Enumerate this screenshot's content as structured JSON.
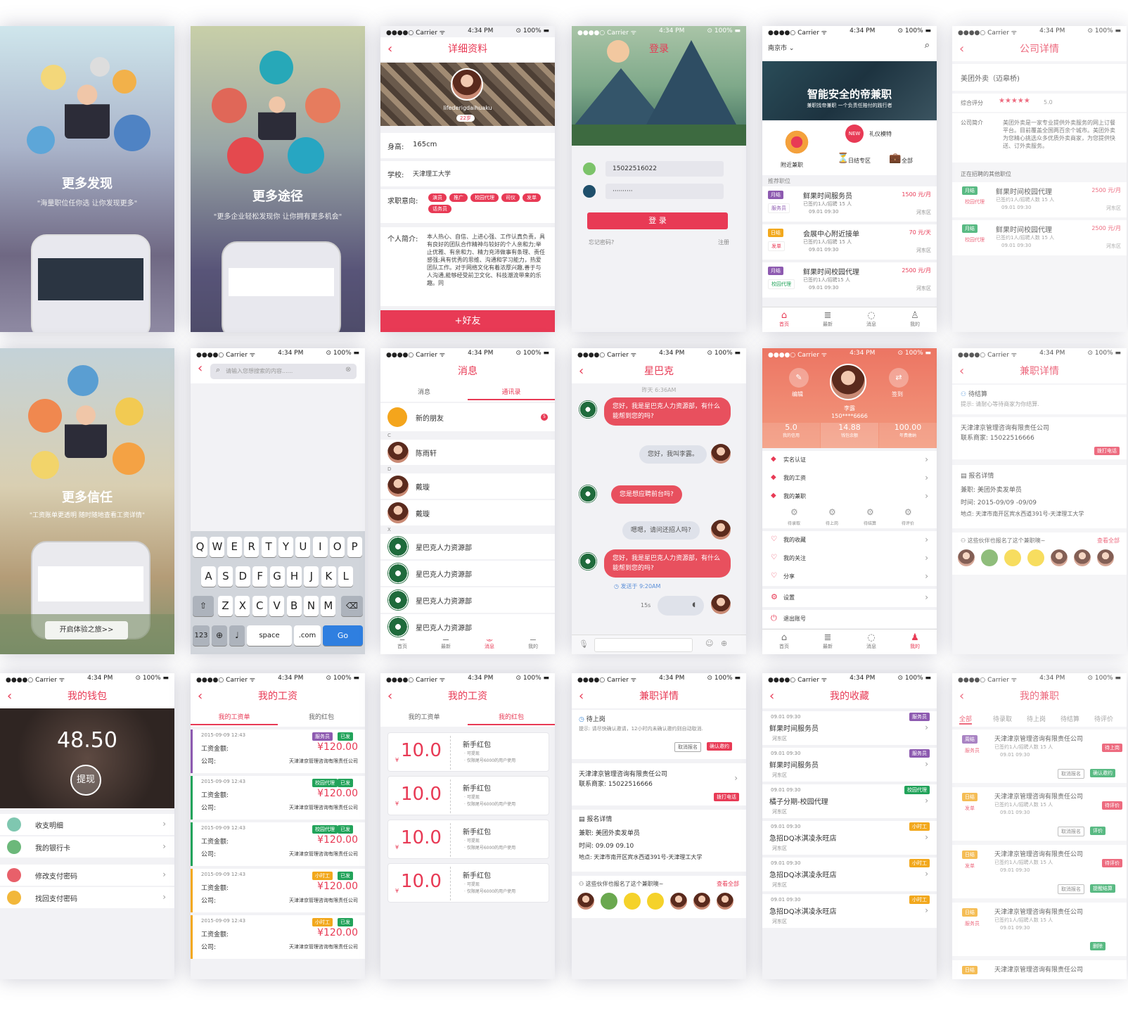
{
  "status": {
    "carrier": "●●●●○ Carrier ᯤ",
    "time": "4:34 PM",
    "battery": "⊙ 100% ▬"
  },
  "onboard1": {
    "title": "更多发现",
    "sub": "\"海量职位任你选 让你发现更多\""
  },
  "onboard2": {
    "title": "更多途径",
    "sub": "\"更多企业轻松发现你 让你拥有更多机会\""
  },
  "onboard3": {
    "title": "更多信任",
    "sub": "\"工资账单更透明 随时随地查看工资详情\"",
    "button": "开启体验之旅>>"
  },
  "profile": {
    "title": "详细资料",
    "username": "lifederigdaihuaku",
    "age": "22岁",
    "height_label": "身高:",
    "height": "165cm",
    "school_label": "学校:",
    "school": "天津理工大学",
    "intent_label": "求职意向:",
    "intents": [
      "演员",
      "推广",
      "校园代理",
      "司仪",
      "发单",
      "话务员"
    ],
    "bio_label": "个人简介:",
    "bio": "本人热心、自信、上进心强、工作认真负责，具有良好的团队合作精神与较好的个人亲和力;举止优雅、有亲和力、精力充沛做事有条理、责任感强;具有优秀的思维、沟通和学习能力，热爱团队工作。对于网络文化有着浓厚兴趣,善于与人沟通,能够经受前卫文化、科技潮流带来的乐趣。同",
    "add": "+好友"
  },
  "login": {
    "title": "登录",
    "phone": "15022516022",
    "password": "··········",
    "button": "登 录",
    "forgot": "忘记密码?",
    "register": "注册"
  },
  "home": {
    "city": "南京市",
    "banner_title": "智能安全的帝兼职",
    "banner_sub": "兼职找帝兼职 一个负责任赔付的践行者",
    "nearby": "附近兼职",
    "etiquette": "礼仪模特",
    "daily": "日结专区",
    "all": "全部",
    "new_badge": "NEW",
    "recommend": "推荐职位",
    "jobs": [
      {
        "tag": "月结",
        "cat": "服务员",
        "title": "鲜果时间服务员",
        "pay": "1500 元/月",
        "count": "已签约1人/招聘 15 人",
        "date": "09.01 09:30",
        "loc": "河东区"
      },
      {
        "tag": "日结",
        "cat": "发单",
        "title": "会展中心附近接单",
        "pay": "70 元/天",
        "count": "已签约1人/招聘 15 人",
        "date": "09.01 09:30",
        "loc": "河东区"
      },
      {
        "tag": "月结",
        "cat": "校园代理",
        "title": "鲜果时间校园代理",
        "pay": "2500 元/月",
        "count": "已签约1人/招聘15 人",
        "date": "09.01 09:30",
        "loc": "河东区"
      }
    ]
  },
  "tabs": {
    "home": "首页",
    "latest": "最新",
    "msg": "消息",
    "mine": "我的"
  },
  "company": {
    "title": "公司详情",
    "name": "美团外卖（迈皋桥)",
    "rating_label": "综合评分",
    "stars": "★★★★★",
    "rating": "5.0",
    "intro_label": "公司简介",
    "intro": "美团外卖是一家专业提供外卖服务的网上订餐平台。目前覆盖全国两百余个城市。美团外卖为您精心挑选众多优质外卖商家，为您提供快送、订外卖服务。",
    "other": "正在招聘的其他职位",
    "jobs": [
      {
        "tag": "月结",
        "cat": "校园代理",
        "title": "鲜果时间校园代理",
        "pay": "2500 元/月",
        "count": "已签约1人/招聘人数 15 人",
        "date": "09.01 09:30",
        "loc": "河东区"
      },
      {
        "tag": "月结",
        "cat": "校园代理",
        "title": "鲜果时间校园代理",
        "pay": "2500 元/月",
        "count": "已签约1人/招聘人数 15 人",
        "date": "09.01 09:30",
        "loc": "河东区"
      }
    ]
  },
  "search": {
    "placeholder": "请输入您想搜索的内容......",
    "row1": [
      "Q",
      "W",
      "E",
      "R",
      "T",
      "Y",
      "U",
      "I",
      "O",
      "P"
    ],
    "row2": [
      "A",
      "S",
      "D",
      "F",
      "G",
      "H",
      "J",
      "K",
      "L"
    ],
    "row3": [
      "Z",
      "X",
      "C",
      "V",
      "B",
      "N",
      "M"
    ],
    "k123": "123",
    "space": "space",
    "com": ".com",
    "go": "Go"
  },
  "contacts": {
    "title": "消息",
    "tab_msg": "消息",
    "tab_contacts": "通讯录",
    "new_friend": "新的朋友",
    "badge": "5",
    "sec_c": "C",
    "sec_d": "D",
    "sec_x": "X",
    "list": [
      "陈雨轩",
      "戴璇",
      "戴璇",
      "星巴克人力资源部",
      "星巴克人力资源部",
      "星巴克人力资源部",
      "星巴克人力资源部"
    ]
  },
  "chat": {
    "title": "星巴克",
    "time": "昨天 6:36AM",
    "m1": "您好，我是星巴克人力资源部，有什么能帮到您的吗?",
    "m2": "您好，我叫李露。",
    "m3": "您是想应聘前台吗?",
    "m4": "嗯嗯，请问还招人吗?",
    "m5": "您好，我是星巴克人力资源部，有什么能帮到您的吗?",
    "sent": "◷ 发送于 9:20AM",
    "voice": "15s"
  },
  "me": {
    "edit": "编辑",
    "sign": "签到",
    "name": "李露",
    "phone": "150****6666",
    "credit": "5.0",
    "credit_l": "我的信用",
    "balance": "14.88",
    "balance_l": "钱包余额",
    "fund": "100.00",
    "fund_l": "年费缴纳",
    "menu": [
      "实名认证",
      "我的工资",
      "我的兼职"
    ],
    "sub": [
      "待录取",
      "待上岗",
      "待结算",
      "待评价"
    ],
    "menu2": [
      "我的收藏",
      "我的关注",
      "分享"
    ],
    "settings": "设置",
    "logout": "退出账号"
  },
  "detail1": {
    "title": "兼职详情",
    "status": "待结算",
    "hint": "提示: 请耐心等待商家为你结算.",
    "company": "天津津京管理咨询有限责任公司",
    "contact": "联系商家: 15022516666",
    "call": "拨打电话",
    "apply": "报名详情",
    "job": "兼职: 美团外卖发单员",
    "time": "时间: 2015-09/09 -09/09",
    "addr": "地点: 天津市南开区宾水西道391号-天津理工大学",
    "fellows": "这些伙伴也报名了这个兼职噢~",
    "more": "查看全部"
  },
  "wallet": {
    "title": "我的钱包",
    "amount": "48.50",
    "withdraw": "提现",
    "items": [
      "收支明细",
      "我的银行卡",
      "修改支付密码",
      "找回支付密码"
    ]
  },
  "wage": {
    "title": "我的工资",
    "tab1": "我的工资单",
    "tab2": "我的红包",
    "date": "2015-09-09 12:43",
    "amount_l": "工资金额:",
    "amount": "¥120.00",
    "company_l": "公司:",
    "company": "天津津京管理咨询有限责任公司",
    "done": "已发",
    "cats": [
      "服务员",
      "校园代理",
      "校园代理",
      "小时工",
      "小时工"
    ]
  },
  "packet": {
    "title": "我的工资",
    "tab1": "我的工资单",
    "tab2": "我的红包",
    "value": "10.0",
    "yen": "¥",
    "name": "新手红包",
    "n1": "· 可提现",
    "n2": "· 仅限尾号6000的用户使用"
  },
  "detail2": {
    "title": "兼职详情",
    "status": "待上岗",
    "hint": "提示: 请尽快确认邀请，12小时内未确认邀约则自动取消.",
    "cancel": "取消报名",
    "confirm": "确认邀约",
    "company": "天津津京管理咨询有限责任公司",
    "contact": "联系商家: 15022516666",
    "call": "拨打电话",
    "apply": "报名详情",
    "job": "兼职: 美团外卖发单员",
    "time": "时间: 09.09 09.10",
    "addr": "地点: 天津市南开区宾水西道391号-天津理工大学",
    "fellows": "这些伙伴也报名了这个兼职噢~",
    "more": "查看全部"
  },
  "fav": {
    "title": "我的收藏",
    "items": [
      {
        "date": "09.01 09:30",
        "title": "鲜果时间服务员",
        "loc": "河东区",
        "cat": "服务员"
      },
      {
        "date": "09.01 09:30",
        "title": "鲜果时间服务员",
        "loc": "河东区",
        "cat": "服务员"
      },
      {
        "date": "09.01 09:30",
        "title": "橘子分期-校园代理",
        "loc": "河东区",
        "cat": "校园代理"
      },
      {
        "date": "09.01 09:30",
        "title": "急招DQ冰淇凌永旺店",
        "loc": "河东区",
        "cat": "小时工"
      },
      {
        "date": "09.01 09:30",
        "title": "急招DQ冰淇凌永旺店",
        "loc": "河东区",
        "cat": "小时工"
      },
      {
        "date": "09.01 09:30",
        "title": "急招DQ冰淇凌永旺店",
        "loc": "河东区",
        "cat": "小时工"
      }
    ]
  },
  "myjobs": {
    "title": "我的兼职",
    "tabs": [
      "全部",
      "待录取",
      "待上岗",
      "待结算",
      "待评价"
    ],
    "company": "天津津京管理咨询有限责任公司",
    "count": "已签约1人/招聘人数 15 人",
    "date": "09.01 09:30",
    "items": [
      {
        "tag": "周结",
        "cat": "服务员",
        "status": "待上岗",
        "a1": "取消报名",
        "a2": "确认邀约"
      },
      {
        "tag": "日结",
        "cat": "发单",
        "status": "待评价",
        "a1": "取消报名",
        "a2": "评价"
      },
      {
        "tag": "日结",
        "cat": "发单",
        "status": "待评价",
        "a1": "取消报名",
        "a2": "提醒结算"
      },
      {
        "tag": "日结",
        "cat": "服务员",
        "status": "",
        "a1": "",
        "a2": "删除"
      },
      {
        "tag": "日结",
        "cat": "",
        "status": "",
        "a1": "",
        "a2": ""
      }
    ]
  }
}
